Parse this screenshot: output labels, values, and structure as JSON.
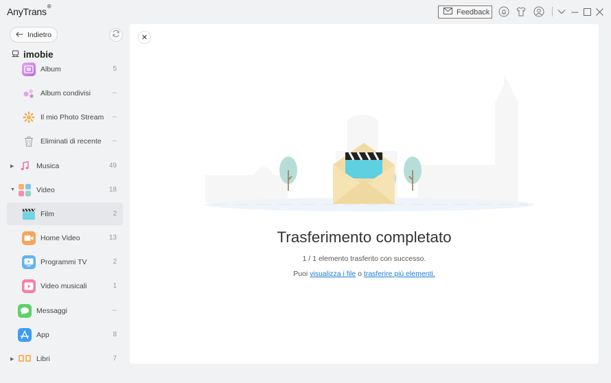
{
  "window": {
    "title": "AnyTrans",
    "title_mark": "®",
    "feedback_label": "Feedback",
    "icons": [
      "mail-icon",
      "bell-icon",
      "tshirt-icon",
      "user-icon",
      "chevron-down-icon",
      "minimize-icon",
      "maximize-icon",
      "close-icon"
    ]
  },
  "sidebar": {
    "back_label": "Indietro",
    "device_name": "imobie",
    "items": [
      {
        "label": "Album",
        "count": "5",
        "level": "sub",
        "icon": "album-icon"
      },
      {
        "label": "Album condivisi",
        "count": "--",
        "level": "sub",
        "icon": "shared-albums-icon"
      },
      {
        "label": "Il mio Photo Stream",
        "count": "--",
        "level": "sub",
        "icon": "photo-stream-icon"
      },
      {
        "label": "Eliminati di recente",
        "count": "--",
        "level": "sub",
        "icon": "trash-icon"
      },
      {
        "label": "Musica",
        "count": "49",
        "level": "top",
        "icon": "music-icon",
        "expanded": false
      },
      {
        "label": "Video",
        "count": "18",
        "level": "top",
        "icon": "video-icon",
        "expanded": true
      },
      {
        "label": "Film",
        "count": "2",
        "level": "sub",
        "icon": "film-icon",
        "selected": true
      },
      {
        "label": "Home Video",
        "count": "13",
        "level": "sub",
        "icon": "home-video-icon"
      },
      {
        "label": "Programmi TV",
        "count": "2",
        "level": "sub",
        "icon": "tv-icon"
      },
      {
        "label": "Video musicali",
        "count": "1",
        "level": "sub",
        "icon": "music-video-icon"
      },
      {
        "label": "Messaggi",
        "count": "--",
        "level": "top",
        "icon": "messages-icon"
      },
      {
        "label": "App",
        "count": "8",
        "level": "top",
        "icon": "app-store-icon"
      },
      {
        "label": "Libri",
        "count": "7",
        "level": "top",
        "icon": "books-icon",
        "expanded": false
      }
    ]
  },
  "main": {
    "title": "Trasferimento completato",
    "subtitle": "1 / 1 elemento trasferito con successo.",
    "links_prefix": "Puoi",
    "link_view": "visualizza i file",
    "links_middle": "o",
    "link_more": "trasferire più elementi."
  },
  "colors": {
    "accent_link": "#1a7bd5",
    "selected_row": "#e6e7ea",
    "envelope": "#f2dca6",
    "tree": "#b7ddd9"
  }
}
